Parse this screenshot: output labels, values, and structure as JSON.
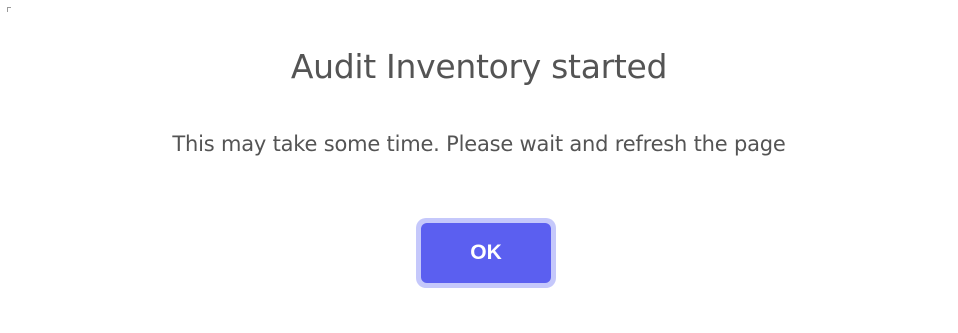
{
  "dialog": {
    "title": "Audit Inventory started",
    "message": "This may take some time. Please wait and refresh the page",
    "ok_label": "OK"
  },
  "colors": {
    "title_text": "#545454",
    "button_bg": "#5b5ff0",
    "button_focus_ring": "#c5c8fb",
    "button_text": "#ffffff"
  }
}
